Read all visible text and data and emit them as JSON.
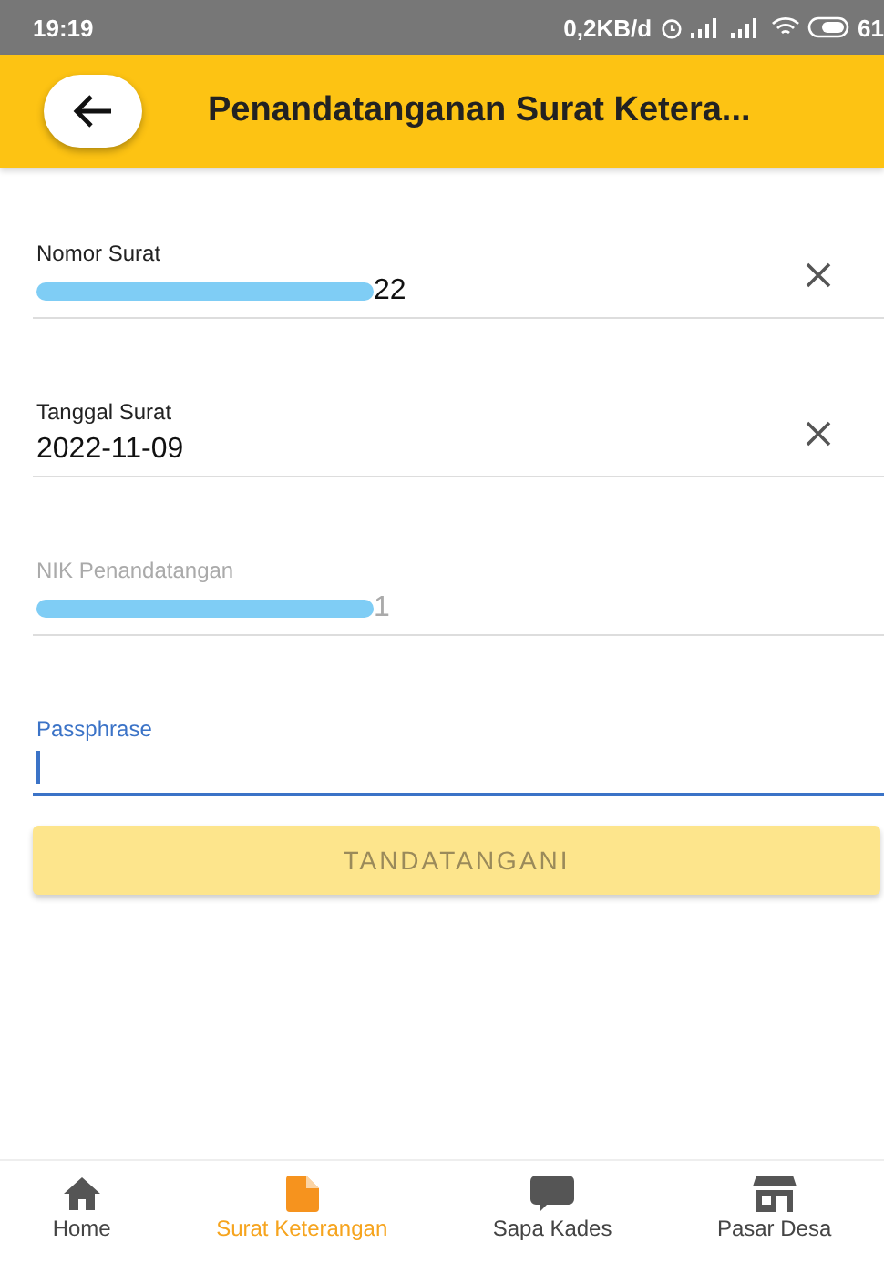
{
  "status_bar": {
    "time": "19:19",
    "speed": "0,2KB/d",
    "battery": "61"
  },
  "header": {
    "title": "Penandatanganan Surat Ketera..."
  },
  "fields": [
    {
      "label": "Nomor Surat",
      "value": "22",
      "redacted": true,
      "clearable": true,
      "disabled": false,
      "focused": false
    },
    {
      "label": "Tanggal Surat",
      "value": "2022-11-09",
      "redacted": false,
      "clearable": true,
      "disabled": false,
      "focused": false
    },
    {
      "label": "NIK Penandatangan",
      "value": "1",
      "redacted": true,
      "clearable": false,
      "disabled": true,
      "focused": false
    },
    {
      "label": "Passphrase",
      "redacted": false,
      "clearable": false,
      "disabled": false,
      "focused": true
    }
  ],
  "submit": {
    "label": "TANDATANGANI",
    "disabled": true
  },
  "nav": [
    {
      "label": "Home",
      "kind": "home",
      "selected": false
    },
    {
      "label": "Surat Keterangan",
      "kind": "document",
      "selected": true
    },
    {
      "label": "Sapa Kades",
      "kind": "chat",
      "selected": false
    },
    {
      "label": "Pasar Desa",
      "kind": "store",
      "selected": false
    }
  ]
}
